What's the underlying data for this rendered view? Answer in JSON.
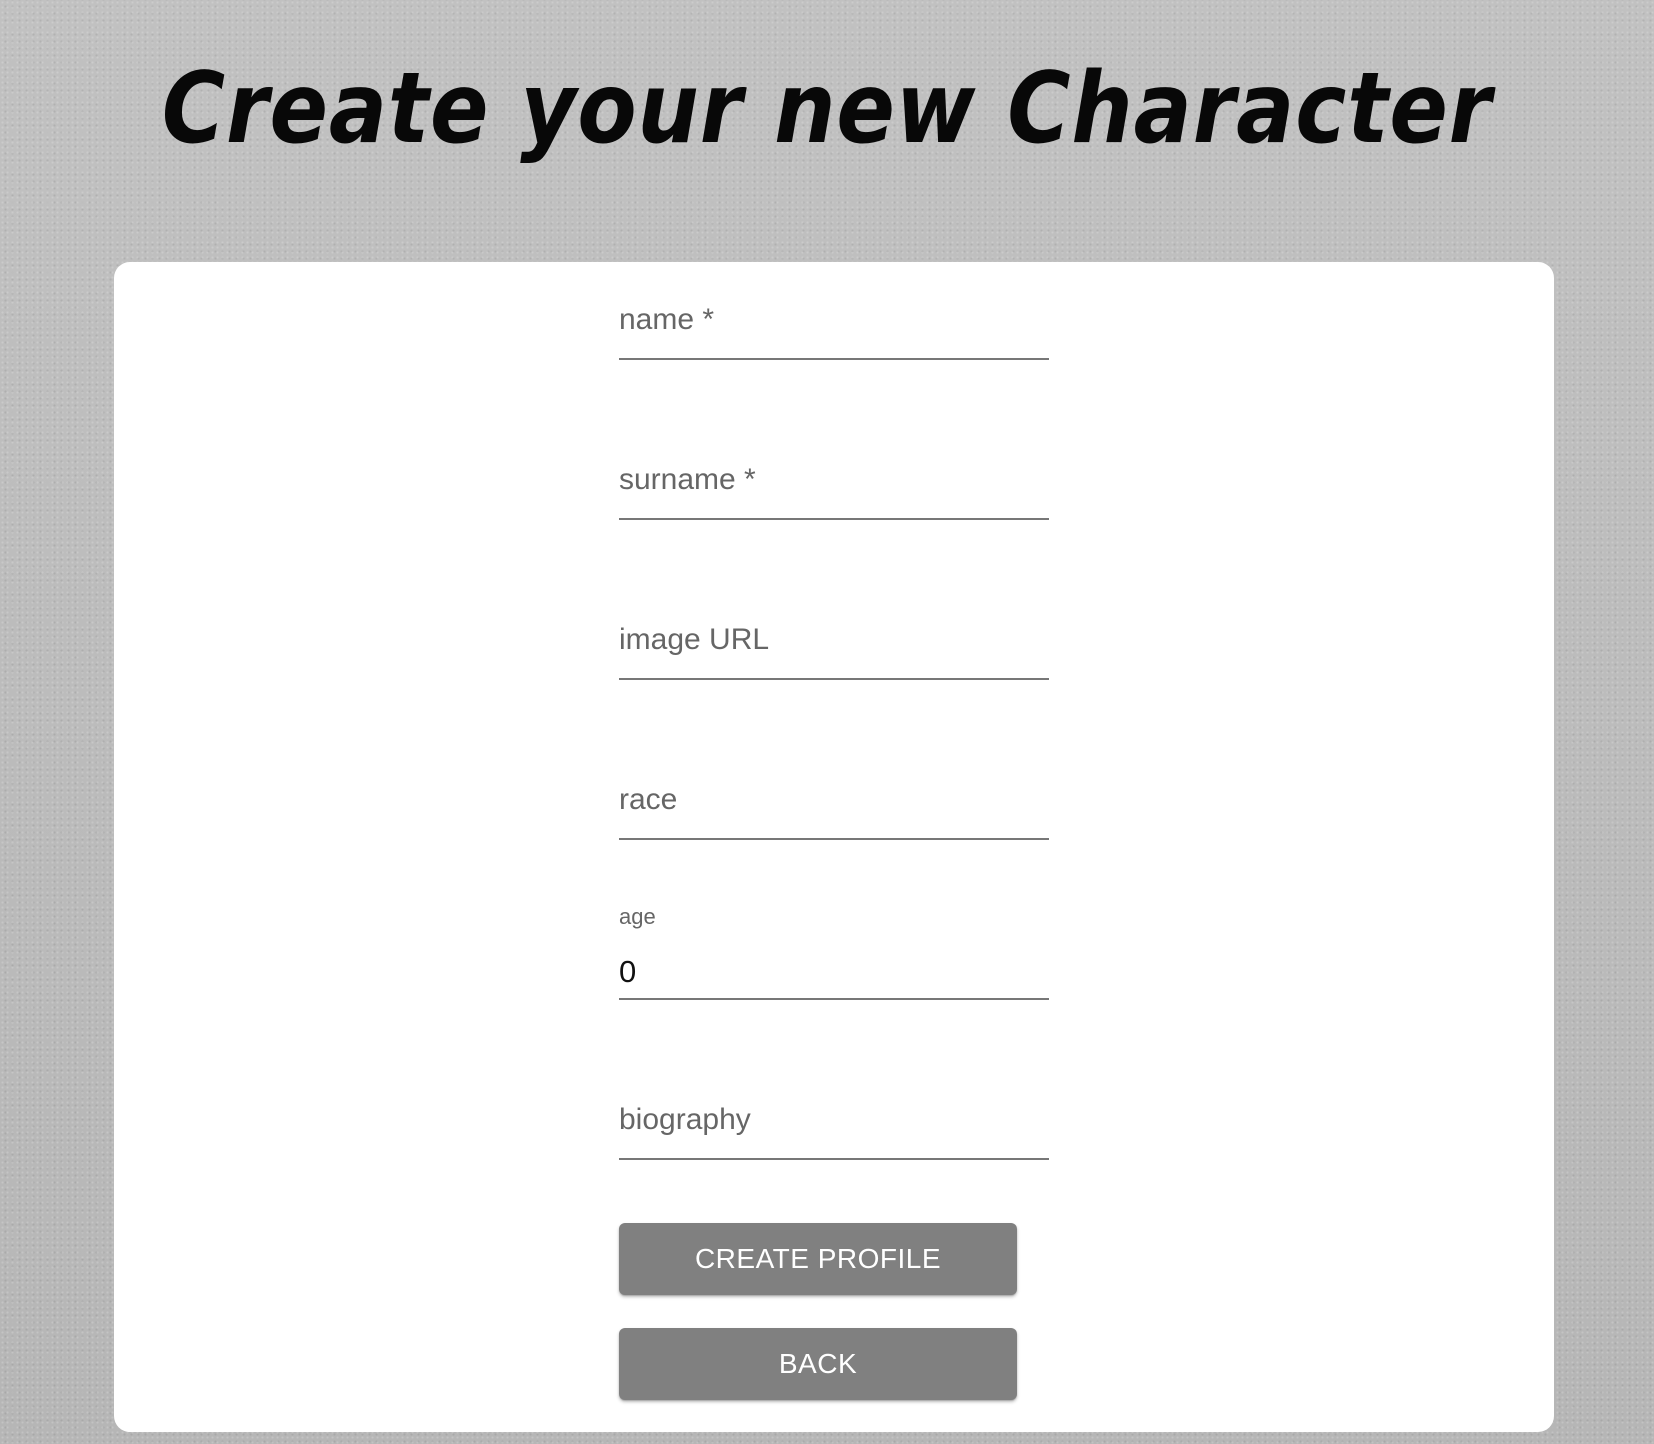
{
  "page": {
    "title": "Create your new Character"
  },
  "form": {
    "fields": [
      {
        "key": "name",
        "label": "name *",
        "value": ""
      },
      {
        "key": "surname",
        "label": "surname *",
        "value": ""
      },
      {
        "key": "image_url",
        "label": "image URL",
        "value": ""
      },
      {
        "key": "race",
        "label": "race",
        "value": ""
      },
      {
        "key": "age",
        "label": "age",
        "value": "0"
      },
      {
        "key": "biography",
        "label": "biography",
        "value": ""
      }
    ],
    "create_button_label": "CREATE PROFILE",
    "back_button_label": "BACK"
  }
}
